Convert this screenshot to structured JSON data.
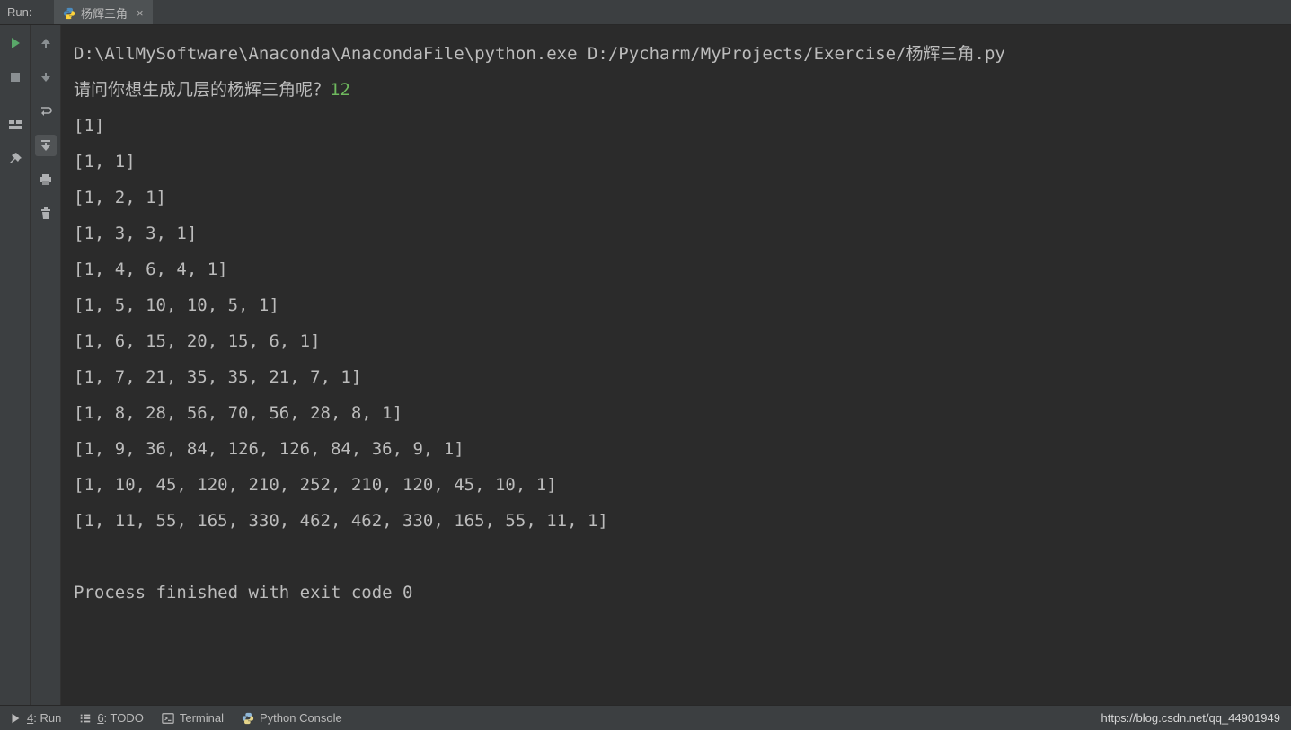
{
  "header": {
    "run_label": "Run:",
    "tab_label": "杨辉三角"
  },
  "console": {
    "command": "D:\\AllMySoftware\\Anaconda\\AnacondaFile\\python.exe D:/Pycharm/MyProjects/Exercise/杨辉三角.py",
    "prompt": "请问你想生成几层的杨辉三角呢？",
    "user_input": "12",
    "rows": [
      "[1]",
      "[1, 1]",
      "[1, 2, 1]",
      "[1, 3, 3, 1]",
      "[1, 4, 6, 4, 1]",
      "[1, 5, 10, 10, 5, 1]",
      "[1, 6, 15, 20, 15, 6, 1]",
      "[1, 7, 21, 35, 35, 21, 7, 1]",
      "[1, 8, 28, 56, 70, 56, 28, 8, 1]",
      "[1, 9, 36, 84, 126, 126, 84, 36, 9, 1]",
      "[1, 10, 45, 120, 210, 252, 210, 120, 45, 10, 1]",
      "[1, 11, 55, 165, 330, 462, 462, 330, 165, 55, 11, 1]"
    ],
    "exit_line": "Process finished with exit code 0"
  },
  "bottom": {
    "run": {
      "accel": "4",
      "label": ": Run"
    },
    "todo": {
      "accel": "6",
      "label": ": TODO"
    },
    "terminal": "Terminal",
    "python_console": "Python Console",
    "watermark": "https://blog.csdn.net/qq_44901949"
  }
}
